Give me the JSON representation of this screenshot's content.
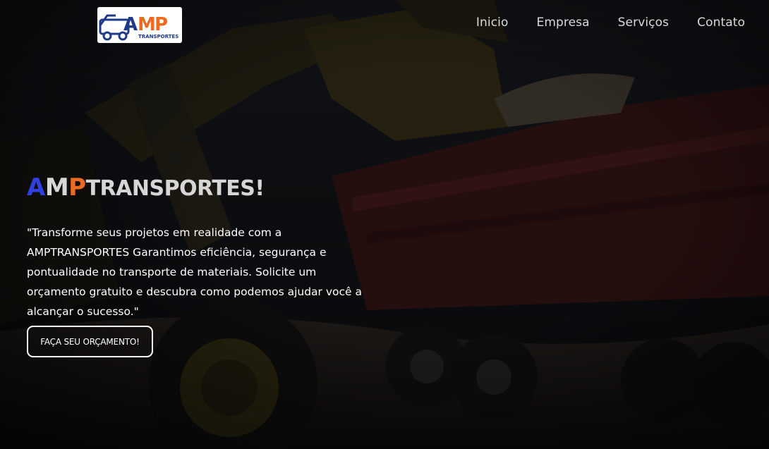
{
  "brand": {
    "logo_letters": [
      "A",
      "M",
      "P"
    ],
    "logo_subtext": "TRANSPORTES",
    "colors": {
      "blue": "#2f3fe0",
      "orange": "#ef6a21",
      "logo_navy": "#1f3a8a"
    }
  },
  "nav": {
    "items": [
      {
        "label": "Inicio"
      },
      {
        "label": "Empresa"
      },
      {
        "label": "Serviços"
      },
      {
        "label": "Contato"
      }
    ]
  },
  "hero": {
    "headline": {
      "a": "A",
      "m": "M",
      "p": "P",
      "rest": "TRANSPORTES!"
    },
    "description": "\"Transforme seus projetos em realidade com a AMPTRANSPORTES Garantimos eficiência, segurança e pontualidade no transporte de materiais. Solicite um orçamento gratuito e descubra como podemos ajudar você a alcançar o sucesso.\"",
    "cta_label": "FAÇA SEU ORÇAMENTO!",
    "background_icon": "construction-photo"
  }
}
